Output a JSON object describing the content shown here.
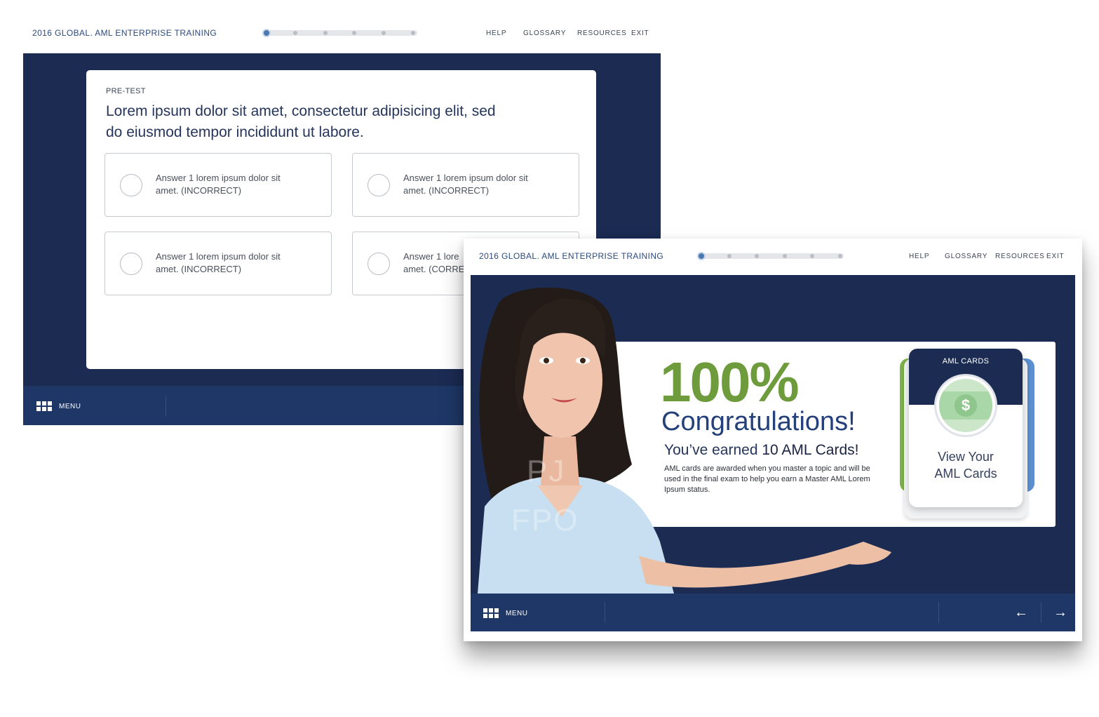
{
  "screen1": {
    "app_title": "2016 GLOBAL. AML ENTERPRISE TRAINING",
    "nav": {
      "help": "HELP",
      "glossary": "GLOSSARY",
      "resources": "RESOURCES",
      "exit": "EXIT"
    },
    "progress": {
      "total_steps": 6,
      "current_step": 1
    },
    "pretest_label": "PRE-TEST",
    "question": "Lorem ipsum dolor sit amet, consectetur adipisicing elit, sed do eiusmod tempor incididunt ut labore.",
    "answers": [
      {
        "line1": "Answer 1 lorem ipsum dolor sit",
        "line2": "amet. (INCORRECT)"
      },
      {
        "line1": "Answer 1 lorem ipsum dolor sit",
        "line2": "amet. (INCORRECT)"
      },
      {
        "line1": "Answer 1 lorem ipsum dolor sit",
        "line2": "amet. (INCORRECT)"
      },
      {
        "line1": "Answer 1 lore",
        "line2": "amet. (CORRE"
      }
    ],
    "menu_label": "MENU"
  },
  "screen2": {
    "app_title": "2016 GLOBAL. AML ENTERPRISE TRAINING",
    "nav": {
      "help": "HELP",
      "glossary": "GLOSSARY",
      "resources": "RESOURCES",
      "exit": "EXIT"
    },
    "progress": {
      "total_steps": 6,
      "current_step": 1
    },
    "percent": "100%",
    "congrats": "Congratulations!",
    "earned_prefix": "You’ve earned",
    "earned_highlight": "10 AML Cards!",
    "earned_description": "AML cards are awarded when you master a topic and will be used in the final exam to help you earn a Master AML Lorem Ipsum status.",
    "card": {
      "title": "AML CARDS",
      "coin_symbol": "$",
      "view_line1": "View Your",
      "view_line2": "AML Cards"
    },
    "watermark": {
      "line1": "PJ",
      "line2": "FPO"
    },
    "menu_label": "MENU",
    "prev_icon": "arrow-left-icon",
    "next_icon": "arrow-right-icon"
  },
  "colors": {
    "navy": "#1b2b52",
    "bar_blue": "#1e3766",
    "green": "#6e9b3c",
    "title_blue": "#2c4a7e"
  }
}
